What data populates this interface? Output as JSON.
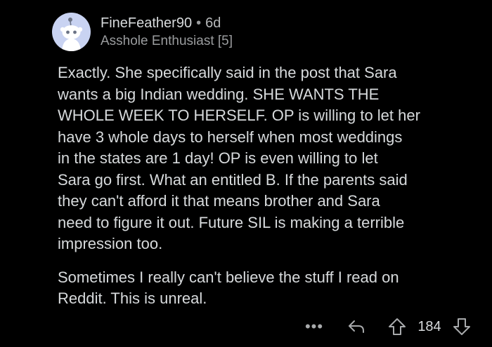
{
  "comment": {
    "username": "FineFeather90",
    "separator": "•",
    "age": "6d",
    "flair": "Asshole Enthusiast [5]",
    "paragraphs": [
      "Exactly. She specifically said in the post that Sara\nwants a big Indian wedding. SHE WANTS THE\nWHOLE WEEK TO HERSELF. OP is willing to let her\nhave 3 whole days to herself when most weddings\nin the states are 1 day! OP is even willing to let\nSara go first. What an entitled B. If the parents said\nthey can't afford it that means brother and Sara\nneed to figure it out.  Future SIL is making a terrible\nimpression too.",
      "Sometimes I really can't believe the stuff I read on\nReddit. This is unreal."
    ]
  },
  "actions": {
    "more_label": "•••",
    "score": "184"
  },
  "icons": {
    "avatar": "reddit-snoo-avatar-icon",
    "reply": "reply-arrow-icon",
    "upvote": "upvote-arrow-icon",
    "downvote": "downvote-arrow-icon"
  },
  "colors": {
    "background": "#000000",
    "text": "#d7dadc",
    "muted": "#9a9c9e",
    "avatar_bg": "#c9d3f2"
  }
}
